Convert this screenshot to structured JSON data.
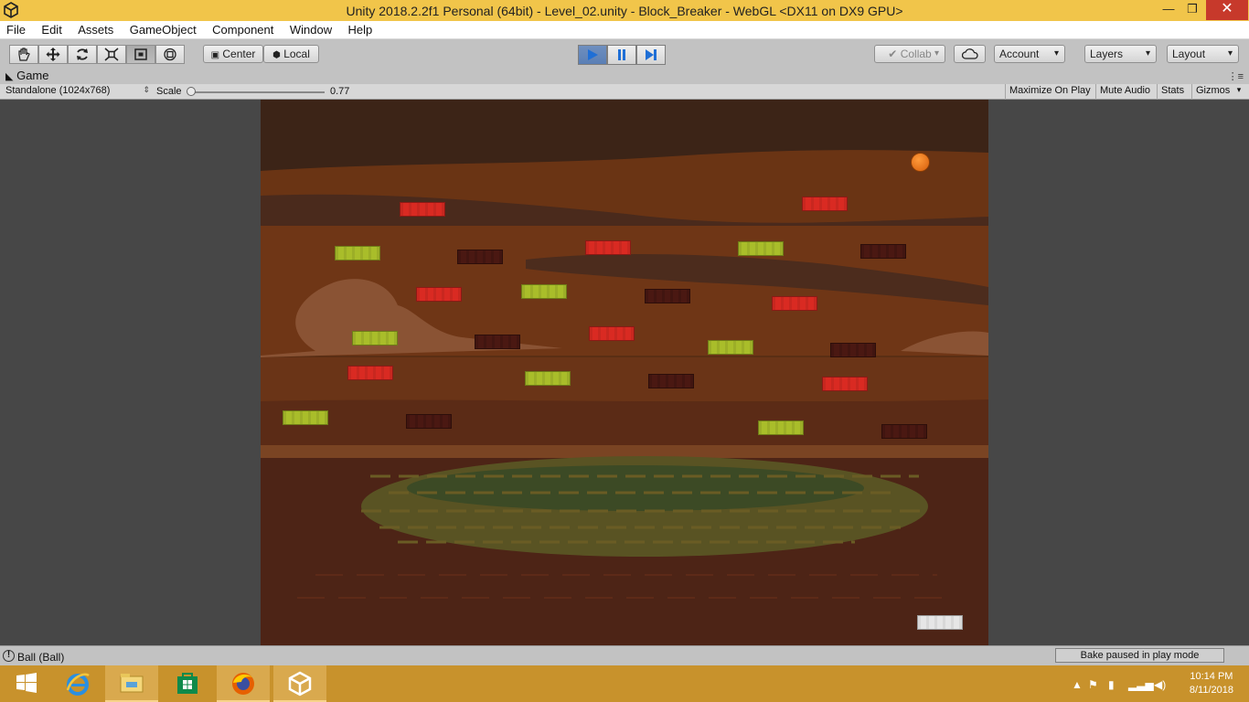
{
  "window": {
    "title": "Unity 2018.2.2f1 Personal (64bit) - Level_02.unity - Block_Breaker - WebGL <DX11 on DX9 GPU>",
    "minimize_icon": "minimize-icon",
    "maximize_icon": "restore-icon",
    "close_icon": "close-icon"
  },
  "menu": [
    "File",
    "Edit",
    "Assets",
    "GameObject",
    "Component",
    "Window",
    "Help"
  ],
  "toolbar": {
    "tools": [
      "hand-icon",
      "move-icon",
      "rotate-icon",
      "scale-icon",
      "rect-tool-icon",
      "transform-icon"
    ],
    "pivot_label": "Center",
    "space_label": "Local",
    "collab_label": "Collab",
    "account_label": "Account",
    "layers_label": "Layers",
    "layout_label": "Layout"
  },
  "game_tab": {
    "label": "Game",
    "resolution": "Standalone (1024x768)",
    "scale_label": "Scale",
    "scale_value": "0.77",
    "maximize_on_play": "Maximize On Play",
    "mute_audio": "Mute Audio",
    "stats": "Stats",
    "gizmos": "Gizmos"
  },
  "game": {
    "block_colors": {
      "red": "#d92a22",
      "green": "#a9bd2a",
      "dark": "#4a1812"
    },
    "blocks": [
      {
        "type": "red"
      },
      {
        "type": "red"
      },
      {
        "type": "green"
      },
      {
        "type": "dark"
      },
      {
        "type": "red"
      },
      {
        "type": "green"
      },
      {
        "type": "dark"
      },
      {
        "type": "red"
      },
      {
        "type": "green"
      },
      {
        "type": "dark"
      },
      {
        "type": "red"
      },
      {
        "type": "green"
      },
      {
        "type": "dark"
      },
      {
        "type": "red"
      },
      {
        "type": "green"
      },
      {
        "type": "dark"
      },
      {
        "type": "red"
      },
      {
        "type": "green"
      },
      {
        "type": "dark"
      },
      {
        "type": "red"
      },
      {
        "type": "green"
      },
      {
        "type": "dark"
      },
      {
        "type": "green"
      },
      {
        "type": "dark"
      }
    ]
  },
  "status": {
    "message": "Ball (Ball)",
    "bake": "Bake paused in play mode"
  },
  "taskbar": {
    "apps": [
      "start-icon",
      "internet-explorer-icon",
      "file-explorer-icon",
      "store-icon",
      "firefox-icon",
      "unity-icon"
    ],
    "time": "10:14 PM",
    "date": "8/11/2018"
  }
}
